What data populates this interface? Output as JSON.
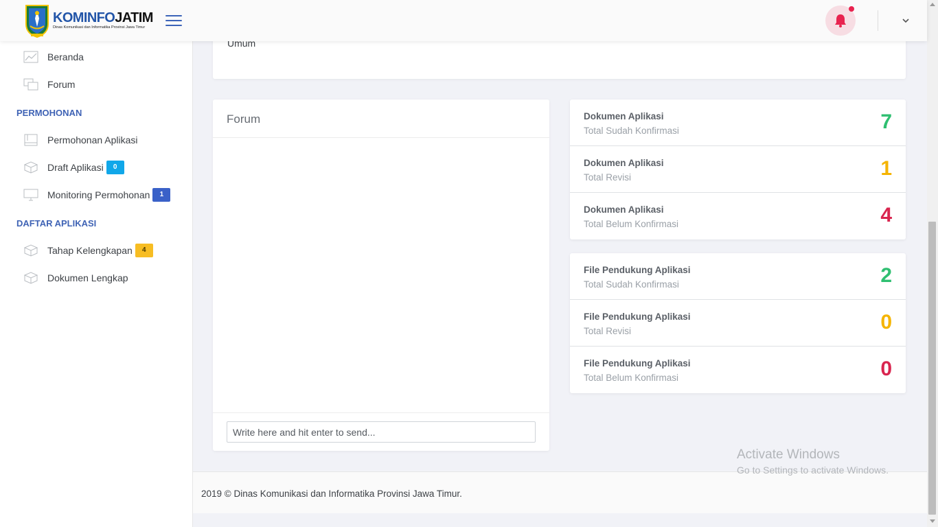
{
  "header": {
    "brand_prefix": "KOMINFO",
    "brand_suffix": "JATIM",
    "brand_subtitle": "Dinas Komunikasi dan Informatika Provinsi Jawa Timur",
    "notification_icon": "bell-icon",
    "menu_icon": "hamburger-icon",
    "user_menu_icon": "chevron-down-icon",
    "bell_color": "#e8234f"
  },
  "sidebar": {
    "items_top": [
      {
        "label": "Beranda",
        "icon": "chart-line-icon"
      },
      {
        "label": "Forum",
        "icon": "chat-bubbles-icon"
      }
    ],
    "section_permohonan": "PERMOHONAN",
    "items_permohonan": [
      {
        "label": "Permohonan Aplikasi",
        "icon": "notebook-icon"
      },
      {
        "label": "Draft Aplikasi",
        "icon": "package-icon",
        "badge": "0"
      },
      {
        "label": "Monitoring Permohonan",
        "icon": "monitor-icon",
        "badge": "1"
      }
    ],
    "section_daftar": "DAFTAR APLIKASI",
    "items_daftar": [
      {
        "label": "Tahap Kelengkapan",
        "icon": "package-icon",
        "badge": "4"
      },
      {
        "label": "Dokumen Lengkap",
        "icon": "package-icon"
      }
    ]
  },
  "top_card": {
    "text": "Umum"
  },
  "forum": {
    "title": "Forum",
    "input_placeholder": "Write here and hit enter to send..."
  },
  "dokumen_stats": [
    {
      "title": "Dokumen Aplikasi",
      "subtitle": "Total Sudah Konfirmasi",
      "value": "7",
      "color": "#2fbf71"
    },
    {
      "title": "Dokumen Aplikasi",
      "subtitle": "Total Revisi",
      "value": "1",
      "color": "#f5b400"
    },
    {
      "title": "Dokumen Aplikasi",
      "subtitle": "Total Belum Konfirmasi",
      "value": "4",
      "color": "#d9254f"
    }
  ],
  "file_stats": [
    {
      "title": "File Pendukung Aplikasi",
      "subtitle": "Total Sudah Konfirmasi",
      "value": "2",
      "color": "#2fbf71"
    },
    {
      "title": "File Pendukung Aplikasi",
      "subtitle": "Total Revisi",
      "value": "0",
      "color": "#f5b400"
    },
    {
      "title": "File Pendukung Aplikasi",
      "subtitle": "Total Belum Konfirmasi",
      "value": "0",
      "color": "#d9254f"
    }
  ],
  "footer": {
    "text": "2019 © Dinas Komunikasi dan Informatika Provinsi Jawa Timur."
  },
  "watermark": {
    "line1": "Activate Windows",
    "line2": "Go to Settings to activate Windows."
  }
}
